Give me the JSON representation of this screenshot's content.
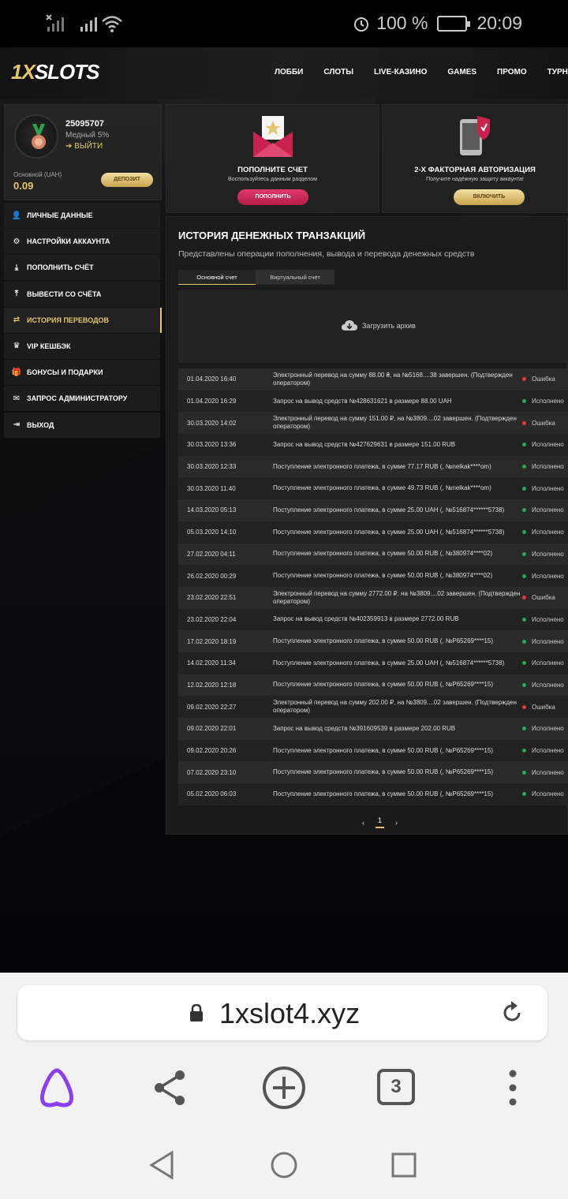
{
  "status_bar": {
    "battery": "100 %",
    "time": "20:09"
  },
  "site": {
    "logo_prefix": "1X",
    "logo_suffix": "SLOTS",
    "nav": [
      "ЛОББИ",
      "СЛОТЫ",
      "LIVE-КАЗИНО",
      "GAMES",
      "ПРОМО",
      "ТУРНИРЫ"
    ]
  },
  "profile": {
    "id": "25095707",
    "rank": "Медный 5%",
    "logout": "ВЫЙТИ",
    "balance_label": "Основной (UAH)",
    "balance": "0.09",
    "deposit": "ДЕПОЗИТ"
  },
  "menu": [
    {
      "label": "ЛИЧНЫЕ ДАННЫЕ",
      "icon": "user-add-icon"
    },
    {
      "label": "НАСТРОЙКИ АККАУНТА",
      "icon": "gears-icon"
    },
    {
      "label": "ПОПОЛНИТЬ СЧЁТ",
      "icon": "download-icon"
    },
    {
      "label": "ВЫВЕСТИ СО СЧЁТА",
      "icon": "upload-icon"
    },
    {
      "label": "ИСТОРИЯ ПЕРЕВОДОВ",
      "icon": "transfer-icon",
      "active": true
    },
    {
      "label": "VIP КЕШБЭК",
      "icon": "crown-icon"
    },
    {
      "label": "БОНУСЫ И ПОДАРКИ",
      "icon": "gift-icon"
    },
    {
      "label": "ЗАПРОС АДМИНИСТРАТОРУ",
      "icon": "mail-icon"
    },
    {
      "label": "ВЫХОД",
      "icon": "exit-icon"
    }
  ],
  "promo": {
    "deposit": {
      "title": "ПОПОЛНИТЕ СЧЕТ",
      "subtitle": "Воспользуйтесь данным разделом",
      "button": "ПОПОЛНИТЬ"
    },
    "twofa": {
      "title": "2-Х ФАКТОРНАЯ АВТОРИЗАЦИЯ",
      "subtitle": "Получите надёжную защиту аккаунта!",
      "button": "ВКЛЮЧИТЬ"
    }
  },
  "history": {
    "title": "ИСТОРИЯ ДЕНЕЖНЫХ ТРАНЗАКЦИЙ",
    "subtitle": "Представлены операции пополнения, вывода и перевода денежных средств",
    "tab_main": "Основной счет",
    "tab_virtual": "Виртуальный счет",
    "archive": "Загрузить архив",
    "page": "1",
    "rows": [
      {
        "date": "01.04.2020 16:40",
        "desc": "Электронный перевод на сумму 88.00 ₴, на №5168....38 завершен. (Подтвержден оператором)",
        "status": "Ошибка",
        "ok": false
      },
      {
        "date": "01.04.2020 16:29",
        "desc": "Запрос на вывод средств №428631621 в размере 88.00 UAH",
        "status": "Исполнено",
        "ok": true
      },
      {
        "date": "30.03.2020 14:02",
        "desc": "Электронный перевод на сумму 151.00 ₽, на №3809....02 завершен. (Подтвержден оператором)",
        "status": "Ошибка",
        "ok": false
      },
      {
        "date": "30.03.2020 13:36",
        "desc": "Запрос на вывод средств №427629631 в размере 151.00 RUB",
        "status": "Исполнено",
        "ok": true
      },
      {
        "date": "30.03.2020 12:33",
        "desc": "Поступление электронного платежа, в сумме 77.17 RUB (, №nelkak****om)",
        "status": "Исполнено",
        "ok": true
      },
      {
        "date": "30.03.2020 11:40",
        "desc": "Поступление электронного платежа, в сумме 49.73 RUB (, №nelkak****om)",
        "status": "Исполнено",
        "ok": true
      },
      {
        "date": "14.03.2020 05:13",
        "desc": "Поступление электронного платежа, в сумме 25.00 UAH (, №516874******5738)",
        "status": "Исполнено",
        "ok": true
      },
      {
        "date": "05.03.2020 14:10",
        "desc": "Поступление электронного платежа, в сумме 25.00 UAH (, №516874******5738)",
        "status": "Исполнено",
        "ok": true
      },
      {
        "date": "27.02.2020 04:11",
        "desc": "Поступление электронного платежа, в сумме 50.00 RUB (, №380974****02)",
        "status": "Исполнено",
        "ok": true
      },
      {
        "date": "26.02.2020 00:29",
        "desc": "Поступление электронного платежа, в сумме 50.00 RUB (, №380974****02)",
        "status": "Исполнено",
        "ok": true
      },
      {
        "date": "23.02.2020 22:51",
        "desc": "Электронный перевод на сумму 2772.00 ₽, на №3809....02 завершен. (Подтвержден оператором)",
        "status": "Ошибка",
        "ok": false
      },
      {
        "date": "23.02.2020 22:04",
        "desc": "Запрос на вывод средств №402359913 в размере 2772.00 RUB",
        "status": "Исполнено",
        "ok": true
      },
      {
        "date": "17.02.2020 18:19",
        "desc": "Поступление электронного платежа, в сумме 50.00 RUB (, №P65269****15)",
        "status": "Исполнено",
        "ok": true
      },
      {
        "date": "14.02.2020 11:34",
        "desc": "Поступление электронного платежа, в сумме 25.00 UAH (, №516874******5738)",
        "status": "Исполнено",
        "ok": true
      },
      {
        "date": "12.02.2020 12:18",
        "desc": "Поступление электронного платежа, в сумме 50.00 RUB (, №P65269****15)",
        "status": "Исполнено",
        "ok": true
      },
      {
        "date": "09.02.2020 22:27",
        "desc": "Электронный перевод на сумму 202.00 ₽, на №3809....02 завершен. (Подтвержден оператором)",
        "status": "Ошибка",
        "ok": false
      },
      {
        "date": "09.02.2020 22:01",
        "desc": "Запрос на вывод средств №391609539 в размере 202.00 RUB",
        "status": "Исполнено",
        "ok": true
      },
      {
        "date": "09.02.2020 20:26",
        "desc": "Поступление электронного платежа, в сумме 50.00 RUB (, №P65269****15)",
        "status": "Исполнено",
        "ok": true
      },
      {
        "date": "07.02.2020 23:10",
        "desc": "Поступление электронного платежа, в сумме 50.00 RUB (, №P65269****15)",
        "status": "Исполнено",
        "ok": true
      },
      {
        "date": "05.02.2020 06:03",
        "desc": "Поступление электронного платежа, в сумме 50.00 RUB (, №P65269****15)",
        "status": "Исполнено",
        "ok": true
      }
    ]
  },
  "browser": {
    "url": "1xslot4.xyz",
    "tabs_count": "3"
  },
  "colors": {
    "gold": "#e5c66f",
    "ok": "#27a85b",
    "error": "#e23b3b",
    "pink": "#e03a6b"
  }
}
